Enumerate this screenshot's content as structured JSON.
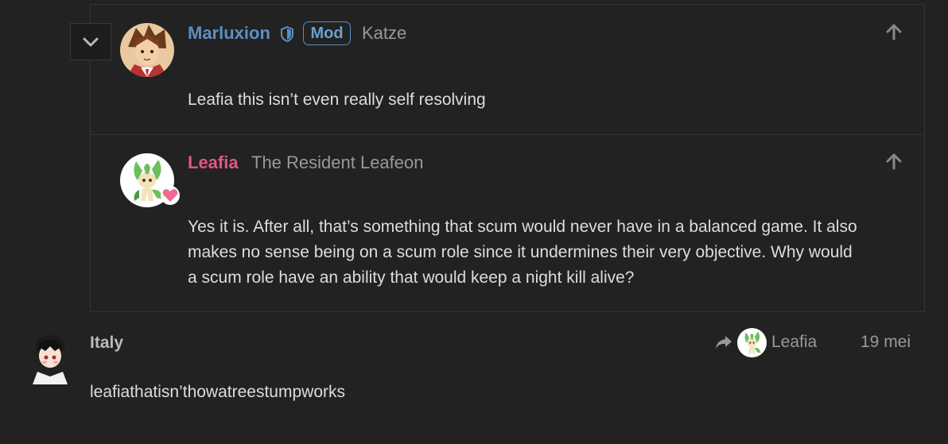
{
  "quote_thread": {
    "posts": [
      {
        "username": "Marluxion",
        "badge": "Mod",
        "user_title": "Katze",
        "text": "Leafia this isn’t even really self resolving",
        "username_color": "#5b8fc4"
      },
      {
        "username": "Leafia",
        "user_title": "The Resident Leafeon",
        "text_lines": [
          "Yes it is. After all, that’s something that scum would never have in a balanced game. It also",
          "makes no sense being on a scum role since it undermines their very objective. Why would",
          "a scum role have an ability that would keep a night kill alive?"
        ],
        "username_color": "#e4567f"
      }
    ]
  },
  "main_post": {
    "username": "Italy",
    "reply_to": "Leafia",
    "date": "19 mei",
    "text": "leafiathatisn’thowatreestumpworks"
  },
  "icons": {
    "expand": "chevron-down-icon",
    "shield": "shield-icon",
    "upvote": "arrow-up-icon",
    "reply": "reply-arrow-icon",
    "heart": "heart-icon"
  },
  "colors": {
    "background": "#222222",
    "border": "#343434",
    "mod_blue": "#5b8fc4",
    "leafia_pink": "#e4567f",
    "muted": "#999999"
  }
}
